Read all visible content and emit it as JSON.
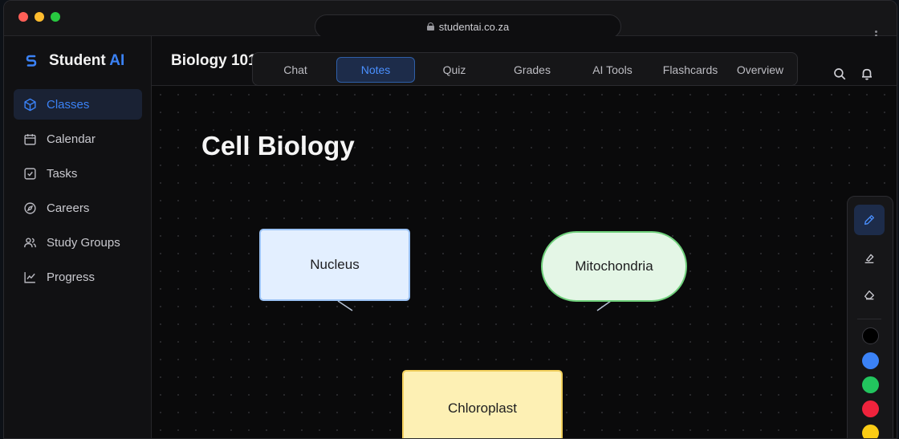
{
  "browser": {
    "url": "studentai.co.za"
  },
  "brand": {
    "name": "Student",
    "suffix": "AI",
    "accent": "#3b82f6"
  },
  "sidebar": {
    "items": [
      {
        "label": "Classes",
        "icon": "cube-icon",
        "active": true
      },
      {
        "label": "Calendar",
        "icon": "calendar-icon"
      },
      {
        "label": "Tasks",
        "icon": "checkbox-icon"
      },
      {
        "label": "Careers",
        "icon": "compass-icon"
      },
      {
        "label": "Study Groups",
        "icon": "users-icon"
      },
      {
        "label": "Progress",
        "icon": "chart-icon"
      }
    ]
  },
  "header": {
    "course_title": "Biology 101",
    "tabs": [
      {
        "label": "Chat"
      },
      {
        "label": "Notes",
        "active": true
      },
      {
        "label": "Quiz"
      },
      {
        "label": "Grades"
      },
      {
        "label": "AI Tools"
      },
      {
        "label": "Flashcards"
      },
      {
        "label": "Overview"
      }
    ],
    "icons": [
      "search-icon",
      "bell-icon"
    ]
  },
  "canvas": {
    "heading": "Cell Biology",
    "nodes": [
      {
        "label": "Nucleus",
        "color": "#e3efff",
        "border": "#9cc3f5"
      },
      {
        "label": "Mitochondria",
        "color": "#e4f6e6",
        "border": "#6fd07b"
      },
      {
        "label": "Chloroplast",
        "color": "#fdf0b4",
        "border": "#f2cf5c"
      }
    ]
  },
  "toolbar": {
    "tools": [
      "pencil-icon",
      "highlighter-icon",
      "eraser-icon"
    ],
    "active_tool": "pencil-icon",
    "colors": [
      "#000000",
      "#3b82f6",
      "#22c55e",
      "#ef233c",
      "#facc15"
    ]
  }
}
